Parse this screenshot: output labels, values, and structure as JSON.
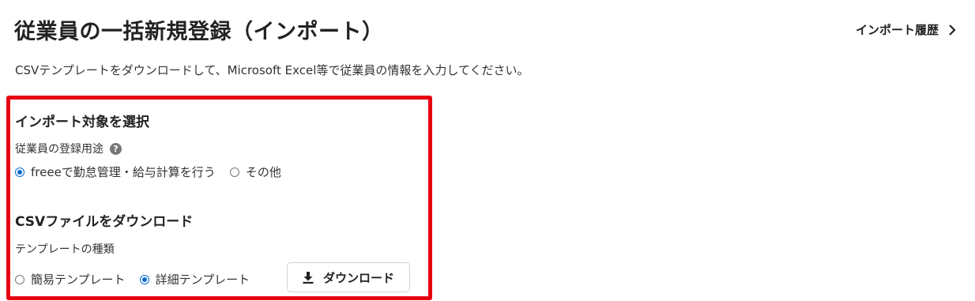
{
  "header": {
    "title": "従業員の一括新規登録（インポート）",
    "history_link": "インポート履歴"
  },
  "description": "CSVテンプレートをダウンロードして、Microsoft Excel等で従業員の情報を入力してください。",
  "import_target": {
    "heading": "インポート対象を選択",
    "field_label": "従業員の登録用途",
    "help_icon": "?",
    "options": [
      {
        "label": "freeeで勤怠管理・給与計算を行う",
        "selected": true
      },
      {
        "label": "その他",
        "selected": false
      }
    ]
  },
  "csv_download": {
    "heading": "CSVファイルをダウンロード",
    "field_label": "テンプレートの種類",
    "options": [
      {
        "label": "簡易テンプレート",
        "selected": false
      },
      {
        "label": "詳細テンプレート",
        "selected": true
      }
    ],
    "button_label": "ダウンロード"
  },
  "colors": {
    "highlight_border": "#e60012",
    "radio_selected": "#0b6bd3"
  },
  "icons": {
    "chevron": "chevron-right-icon",
    "help": "question-circle-icon",
    "download": "download-icon"
  }
}
